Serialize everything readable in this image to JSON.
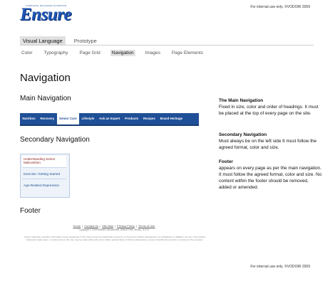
{
  "brand": {
    "tagline": "COMPLETE, BALANCED NUTRITION",
    "name": "Ensure",
    "note_top": "For internal use only. ©VODORI 2009",
    "note_bottom": "For internal use only. ©VODORI 2009"
  },
  "tabs": [
    {
      "label": "Visual Language",
      "active": true
    },
    {
      "label": "Prototype",
      "active": false
    }
  ],
  "subnav": [
    {
      "label": "Color",
      "active": false
    },
    {
      "label": "Typography",
      "active": false
    },
    {
      "label": "Page Grid",
      "active": false
    },
    {
      "label": "Navigation",
      "active": true
    },
    {
      "label": "Images",
      "active": false
    },
    {
      "label": "Page Elements",
      "active": false
    }
  ],
  "page": {
    "title": "Navigation",
    "main_nav_heading": "Main Navigation",
    "secondary_nav_heading": "Secondary Navigation",
    "footer_heading": "Footer"
  },
  "main_nav": [
    {
      "label": "Nutrition",
      "active": false
    },
    {
      "label": "Recovery",
      "active": false
    },
    {
      "label": "Senior Care",
      "active": true
    },
    {
      "label": "Lifestyle",
      "active": false
    },
    {
      "label": "Ask an Expert",
      "active": false
    },
    {
      "label": "Products",
      "active": false
    },
    {
      "label": "Recipes",
      "active": false
    },
    {
      "label": "Brand Heritage",
      "active": false
    }
  ],
  "secondary_nav": [
    {
      "label": "Understanding Senior Malnutrition"
    },
    {
      "label": "Exercise: Getting Started"
    },
    {
      "label": "Age-Related Depression"
    }
  ],
  "footer_sample": {
    "links": [
      "Home",
      "Contact Us",
      "Site Map",
      "Privacy Policy",
      "Terms of Use"
    ],
    "copyright": "Copyright © 2009 Abbott Laboratories, Abbott Park, Illinois, U.S.A.",
    "legal": "Unless otherwise specified, all product names appearing in this Internet site are trademarks owned by or licensed to Abbott Laboratories, its subsidiaries or affiliates. No use of any Abbott trademark, trade name, or trade dress in this site may be made without the prior written authorization of Abbott Laboratories, except to identify the product or services of the company."
  },
  "descriptions": {
    "main": {
      "title": "The Main Navigation",
      "body": "Fixed in size, color and order of headings. It must be placed at the top of every page on the site."
    },
    "secondary": {
      "title": "Secondary Navigation",
      "body": "Must always be on the left side It must follow the agreed format, color and size."
    },
    "footer": {
      "title": "Footer",
      "body": "appears on every page as per the main navigation. It must follow the agreed format, color and size. No content within the footer should be removed, added or amended."
    }
  },
  "colors": {
    "nav_blue": "#1f4f96",
    "brand_blue": "#1f56b5",
    "secondary_red": "#8b1b1b"
  }
}
